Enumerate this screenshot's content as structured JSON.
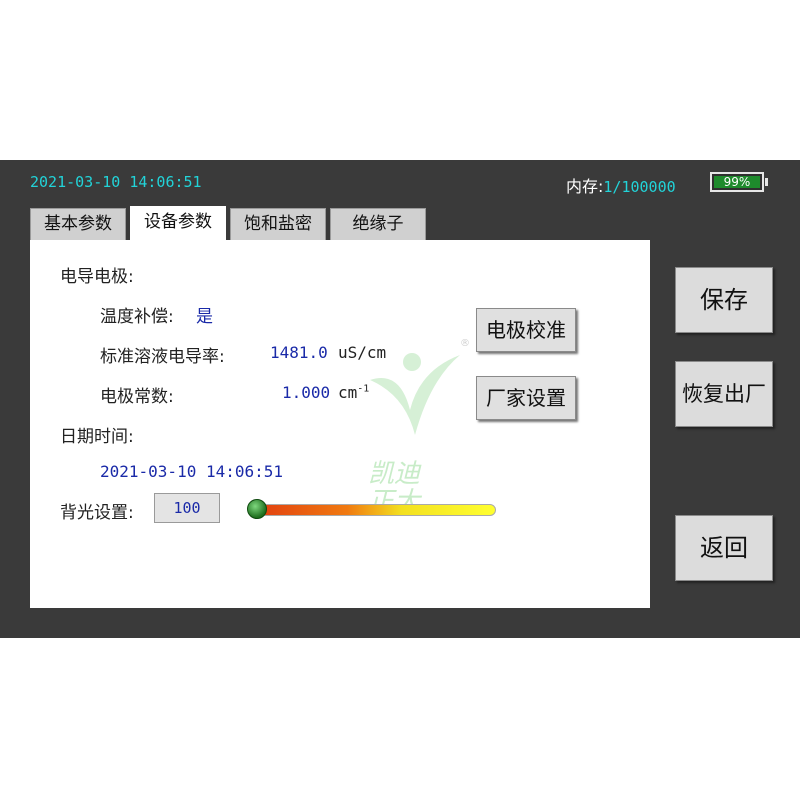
{
  "status_bar": {
    "datetime": "2021-03-10 14:06:51",
    "memory_label": "内存:",
    "memory_value": "1/100000",
    "battery_text": "99%",
    "battery_level": 0.99
  },
  "tabs": [
    {
      "label": "基本参数",
      "active": false
    },
    {
      "label": "设备参数",
      "active": true
    },
    {
      "label": "饱和盐密",
      "active": false
    },
    {
      "label": "绝缘子",
      "active": false
    }
  ],
  "panel": {
    "electrode_section": "电导电极:",
    "temp_comp_label": "温度补偿:",
    "temp_comp_value": "是",
    "std_conductivity_label": "标准溶液电导率:",
    "std_conductivity_value": "1481.0",
    "std_conductivity_unit": "uS/cm",
    "electrode_const_label": "电极常数:",
    "electrode_const_value": "1.000",
    "electrode_const_unit": "cm",
    "electrode_const_sup": "-1",
    "datetime_section": "日期时间:",
    "datetime_value": "2021-03-10 14:06:51",
    "backlight_label": "背光设置:",
    "backlight_value": "100",
    "backlight_level": 0.0,
    "calibrate_button": "电极校准",
    "factory_settings_button": "厂家设置",
    "watermark": [
      "凯迪",
      "正大"
    ],
    "watermark_reg": "®"
  },
  "side_buttons": {
    "save": "保存",
    "restore": "恢复出厂",
    "back": "返回"
  },
  "colors": {
    "screen_bg": "#3a3a3a",
    "status_text": "#22d3d8",
    "value_blue": "#1a2aa8",
    "battery_green": "#1e8a2c"
  }
}
